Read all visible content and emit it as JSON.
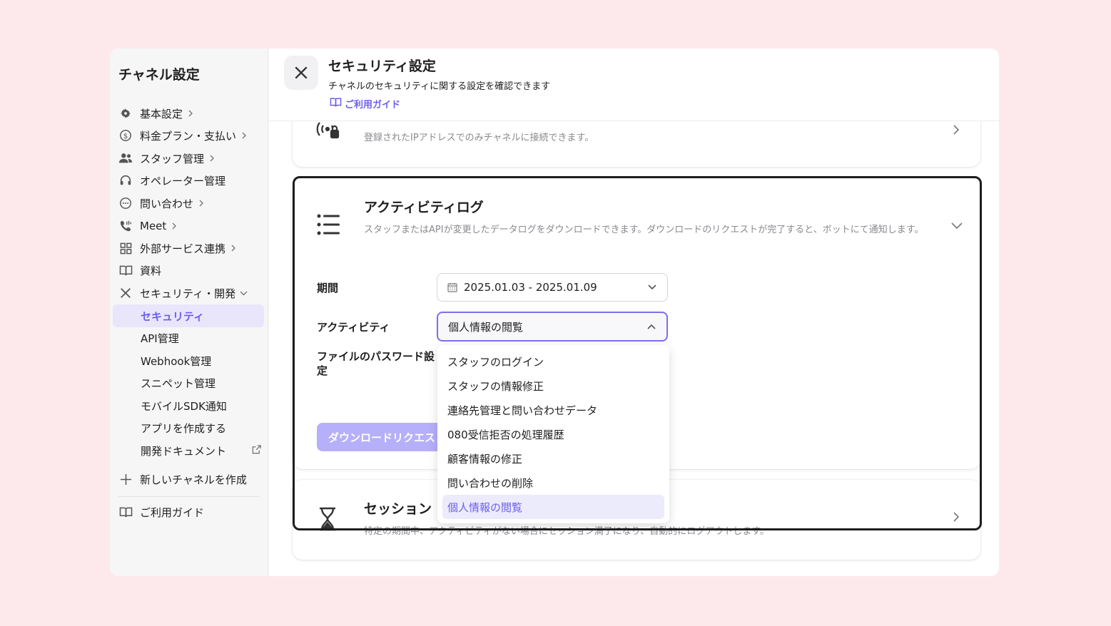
{
  "sidebar": {
    "title": "チャネル設定",
    "items": [
      {
        "label": "基本設定",
        "icon": "gear-icon",
        "chevron": true
      },
      {
        "label": "料金プラン・支払い",
        "icon": "dollar-icon",
        "chevron": true
      },
      {
        "label": "スタッフ管理",
        "icon": "people-icon",
        "chevron": true
      },
      {
        "label": "オペレーター管理",
        "icon": "headset-icon",
        "chevron": false
      },
      {
        "label": "問い合わせ",
        "icon": "chat-icon",
        "chevron": true
      },
      {
        "label": "Meet",
        "icon": "phone-icon",
        "chevron": true
      },
      {
        "label": "外部サービス連携",
        "icon": "grid-icon",
        "chevron": true
      },
      {
        "label": "資料",
        "icon": "book-icon",
        "chevron": false
      },
      {
        "label": "セキュリティ・開発",
        "icon": "tools-icon",
        "chevron": "down"
      }
    ],
    "sub_items": [
      {
        "label": "セキュリティ",
        "active": true
      },
      {
        "label": "API管理"
      },
      {
        "label": "Webhook管理"
      },
      {
        "label": "スニペット管理"
      },
      {
        "label": "モバイルSDK通知"
      },
      {
        "label": "アプリを作成する"
      },
      {
        "label": "開発ドキュメント",
        "external": true
      }
    ],
    "new_channel": "新しいチャネルを作成",
    "guide": "ご利用ガイド"
  },
  "header": {
    "title": "セキュリティ設定",
    "subtitle": "チャネルのセキュリティに関する設定を確認できます",
    "guide_link": "ご利用ガイド"
  },
  "ip_card": {
    "desc": "登録されたIPアドレスでのみチャネルに接続できます。"
  },
  "activity_log": {
    "title": "アクティビティログ",
    "desc": "スタッフまたはAPIが変更したデータログをダウンロードできます。ダウンロードのリクエストが完了すると、ボットにて通知します。",
    "period_label": "期間",
    "period_value": "2025.01.03 - 2025.01.09",
    "activity_label": "アクティビティ",
    "activity_value": "個人情報の閲覧",
    "password_label": "ファイルのパスワード設定",
    "download_button": "ダウンロードリクエスト"
  },
  "dropdown": {
    "options": [
      "スタッフのログイン",
      "スタッフの情報修正",
      "連絡先管理と問い合わせデータ",
      "080受信拒否の処理履歴",
      "顧客情報の修正",
      "問い合わせの削除",
      "個人情報の閲覧"
    ],
    "selected_index": 6
  },
  "session_card": {
    "title": "セッション",
    "desc": "特定の期間中、アクティビティがない場合にセッション満了になり、自動的にログアウトします。"
  },
  "colors": {
    "accent": "#6b5ef0",
    "accent_light": "#e9e6fb",
    "background": "#fde9ec"
  }
}
